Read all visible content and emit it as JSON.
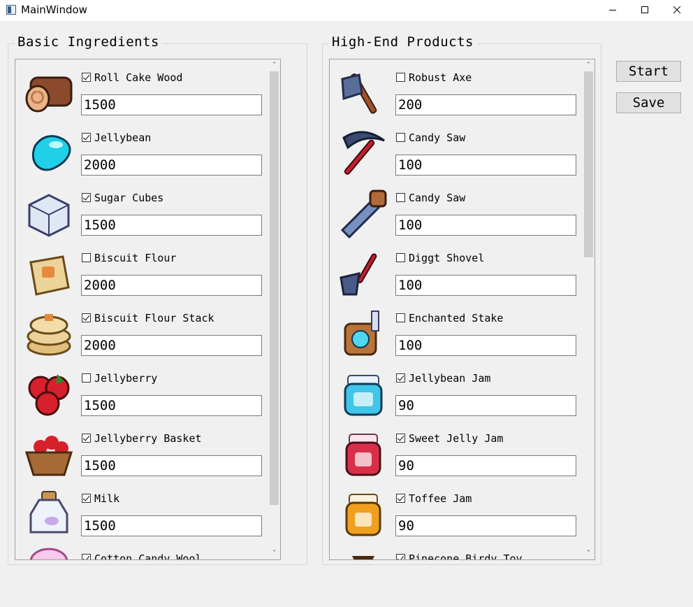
{
  "window": {
    "title": "MainWindow"
  },
  "left_group": {
    "title": "Basic Ingredients",
    "items": [
      {
        "label": "Roll Cake Wood",
        "checked": true,
        "value": "1500",
        "icon": "roll-cake-wood-icon"
      },
      {
        "label": "Jellybean",
        "checked": true,
        "value": "2000",
        "icon": "jellybean-icon"
      },
      {
        "label": "Sugar Cubes",
        "checked": true,
        "value": "1500",
        "icon": "sugar-cube-icon"
      },
      {
        "label": "Biscuit Flour",
        "checked": false,
        "value": "2000",
        "icon": "biscuit-flour-icon"
      },
      {
        "label": "Biscuit Flour Stack",
        "checked": true,
        "value": "2000",
        "icon": "biscuit-flour-stack-icon"
      },
      {
        "label": "Jellyberry",
        "checked": false,
        "value": "1500",
        "icon": "jellyberry-icon"
      },
      {
        "label": "Jellyberry Basket",
        "checked": true,
        "value": "1500",
        "icon": "jellyberry-basket-icon"
      },
      {
        "label": "Milk",
        "checked": true,
        "value": "1500",
        "icon": "milk-icon"
      },
      {
        "label": "Cotton Candy Wool",
        "checked": true,
        "value": "",
        "icon": "cotton-candy-wool-icon"
      }
    ]
  },
  "right_group": {
    "title": "High-End Products",
    "items": [
      {
        "label": "Robust Axe",
        "checked": false,
        "value": "200",
        "icon": "axe-icon"
      },
      {
        "label": "Candy Saw",
        "checked": false,
        "value": "100",
        "icon": "pickaxe-icon"
      },
      {
        "label": "Candy Saw",
        "checked": false,
        "value": "100",
        "icon": "saw-icon"
      },
      {
        "label": "Diggt Shovel",
        "checked": false,
        "value": "100",
        "icon": "shovel-icon"
      },
      {
        "label": "Enchanted Stake",
        "checked": false,
        "value": "100",
        "icon": "stake-icon"
      },
      {
        "label": "Jellybean Jam",
        "checked": true,
        "value": "90",
        "icon": "jellybean-jam-icon"
      },
      {
        "label": "Sweet Jelly Jam",
        "checked": true,
        "value": "90",
        "icon": "sweet-jelly-jam-icon"
      },
      {
        "label": "Toffee Jam",
        "checked": true,
        "value": "90",
        "icon": "toffee-jam-icon"
      },
      {
        "label": "Pinecone Birdy Toy",
        "checked": true,
        "value": "",
        "icon": "pinecone-icon"
      }
    ]
  },
  "buttons": {
    "start": "Start",
    "save": "Save"
  }
}
